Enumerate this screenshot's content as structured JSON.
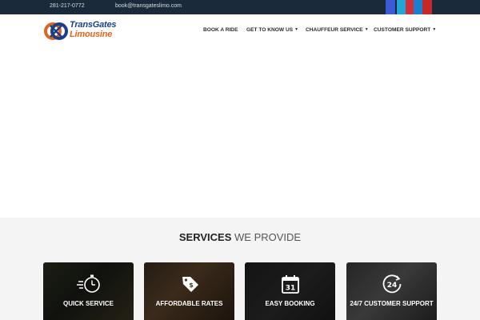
{
  "topbar": {
    "phone": "281-217-0772",
    "email": "book@transgateslimo.com",
    "social_colors": [
      "#3b5bd6",
      "#1fa7d8",
      "#d32f3a",
      "#1a7fd0",
      "#c62828"
    ]
  },
  "logo": {
    "line1": "TransGates",
    "line2": "Limousine"
  },
  "nav": {
    "items": [
      {
        "label": "BOOK A RIDE",
        "dropdown": false
      },
      {
        "label": "GET TO KNOW US",
        "dropdown": true
      },
      {
        "label": "CHAUFFEUR SERVICE",
        "dropdown": true
      },
      {
        "label": "CUSTOMER SUPPORT",
        "dropdown": true
      }
    ]
  },
  "services": {
    "title_bold": "SERVICES",
    "title_light": "WE PROVIDE",
    "cards": [
      {
        "label": "QUICK SERVICE",
        "icon": "stopwatch-icon"
      },
      {
        "label": "AFFORDABLE RATES",
        "icon": "price-tag-icon"
      },
      {
        "label": "EASY BOOKING",
        "icon": "calendar-icon"
      },
      {
        "label": "24/7 CUSTOMER SUPPORT",
        "icon": "24-hour-icon"
      }
    ]
  },
  "colors": {
    "topbar": "#1b2a3a",
    "logo_blue": "#1c3f86",
    "logo_orange": "#e0651f",
    "section_bg": "#f4f4f4"
  }
}
